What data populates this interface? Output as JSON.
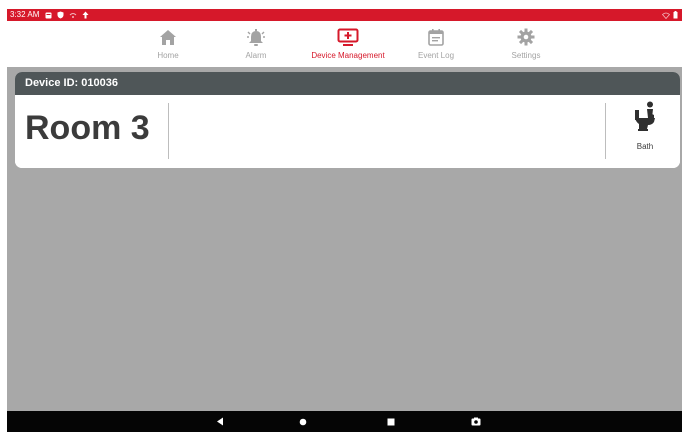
{
  "status_bar": {
    "time": "3:32 AM",
    "icons": [
      "notification-icon",
      "shield-icon",
      "signal-icon",
      "upload-icon"
    ],
    "right_icons": [
      "wifi-icon",
      "battery-icon"
    ]
  },
  "tabs": [
    {
      "label": "Home",
      "icon": "home-icon",
      "active": false
    },
    {
      "label": "Alarm",
      "icon": "alarm-bell-icon",
      "active": false
    },
    {
      "label": "Device Management",
      "icon": "device-management-icon",
      "active": true
    },
    {
      "label": "Event Log",
      "icon": "calendar-icon",
      "active": false
    },
    {
      "label": "Settings",
      "icon": "gear-icon",
      "active": false
    }
  ],
  "device": {
    "header": "Device ID: 010036",
    "room_name": "Room 3",
    "sensor": {
      "label": "Bath",
      "icon": "bath-toilet-icon"
    }
  },
  "nav_bar": [
    "back-icon",
    "home-circle-icon",
    "recents-icon",
    "screenshot-icon"
  ],
  "colors": {
    "accent": "#d6182a",
    "header_bg": "#4f5658",
    "body_bg": "#a8a8a8",
    "inactive_tab": "#a3a3a3"
  }
}
